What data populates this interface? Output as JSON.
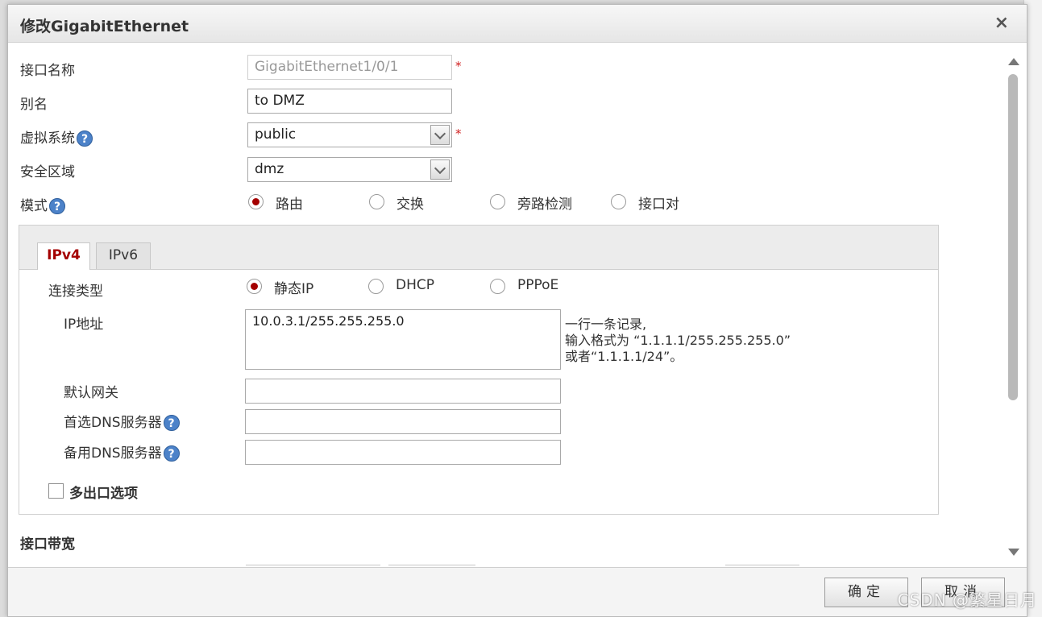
{
  "dialog": {
    "title": "修改GigabitEthernet",
    "close": "×"
  },
  "form": {
    "interface_name": {
      "label": "接口名称",
      "value": "GigabitEthernet1/0/1",
      "required": "*"
    },
    "alias": {
      "label": "别名",
      "value": "to DMZ"
    },
    "vsys": {
      "label": "虚拟系统",
      "value": "public",
      "required": "*"
    },
    "zone": {
      "label": "安全区域",
      "value": "dmz"
    },
    "mode": {
      "label": "模式",
      "options": [
        "路由",
        "交换",
        "旁路检测",
        "接口对"
      ],
      "selected": "路由"
    }
  },
  "tabs": {
    "ipv4": "IPv4",
    "ipv6": "IPv6",
    "active": "IPv4"
  },
  "ipv4": {
    "conn_type": {
      "label": "连接类型",
      "options": [
        "静态IP",
        "DHCP",
        "PPPoE"
      ],
      "selected": "静态IP"
    },
    "ip": {
      "label": "IP地址",
      "value": "10.0.3.1/255.255.255.0",
      "hint1": "一行一条记录,",
      "hint2": "输入格式为 “1.1.1.1/255.255.255.0”",
      "hint3": "或者“1.1.1.1/24”。"
    },
    "gateway": {
      "label": "默认网关",
      "value": ""
    },
    "dns1": {
      "label": "首选DNS服务器",
      "value": ""
    },
    "dns2": {
      "label": "备用DNS服务器",
      "value": ""
    },
    "multi_exit": {
      "label": "多出口选项",
      "checked": false
    }
  },
  "bandwidth": {
    "label": "接口带宽"
  },
  "help_glyph": "?",
  "footer": {
    "ok": "确定",
    "cancel": "取消"
  },
  "watermark": "CSDN @繁星日月",
  "colors": {
    "accent": "#a40000",
    "help": "#4c82c9",
    "required": "#d02020"
  }
}
